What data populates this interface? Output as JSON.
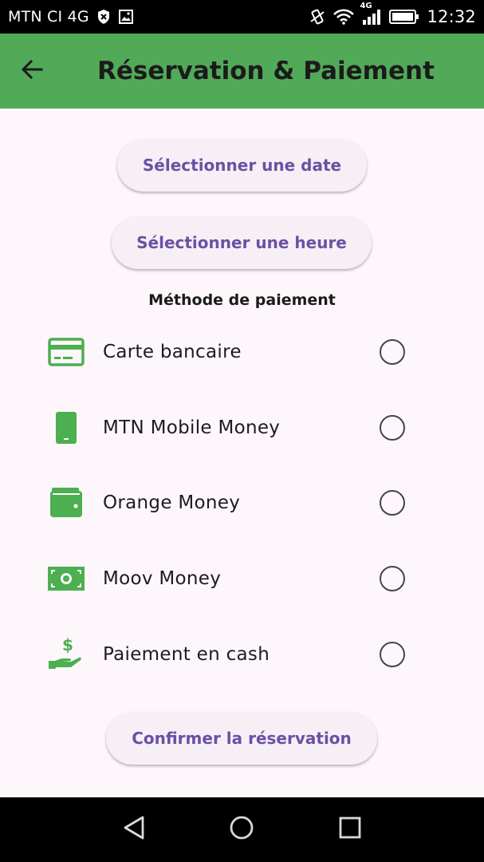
{
  "status_bar": {
    "carrier": "MTN CI 4G",
    "network_type": "4G",
    "time": "12:32",
    "icons": [
      "blocked-icon",
      "image-icon",
      "vibrate-icon",
      "wifi-icon",
      "signal-icon",
      "battery-icon"
    ]
  },
  "app_bar": {
    "back_icon": "arrow-left-icon",
    "title": "Réservation & Paiement"
  },
  "actions": {
    "select_date_label": "Sélectionner une date",
    "select_time_label": "Sélectionner une heure",
    "confirm_label": "Confirmer la réservation"
  },
  "payment": {
    "section_title": "Méthode de paiement",
    "methods": [
      {
        "label": "Carte bancaire",
        "icon": "credit-card-icon",
        "selected": false
      },
      {
        "label": "MTN Mobile Money",
        "icon": "smartphone-icon",
        "selected": false
      },
      {
        "label": "Orange Money",
        "icon": "wallet-icon",
        "selected": false
      },
      {
        "label": "Moov Money",
        "icon": "money-bill-icon",
        "selected": false
      },
      {
        "label": "Paiement en cash",
        "icon": "cash-hand-icon",
        "selected": false
      }
    ]
  },
  "colors": {
    "app_bar": "#51aa58",
    "icon_green": "#4caf50",
    "button_text": "#6b50a4",
    "background": "#fdf7fc"
  },
  "nav_bar": {
    "icons": [
      "back-triangle-icon",
      "home-circle-icon",
      "recents-square-icon"
    ]
  }
}
